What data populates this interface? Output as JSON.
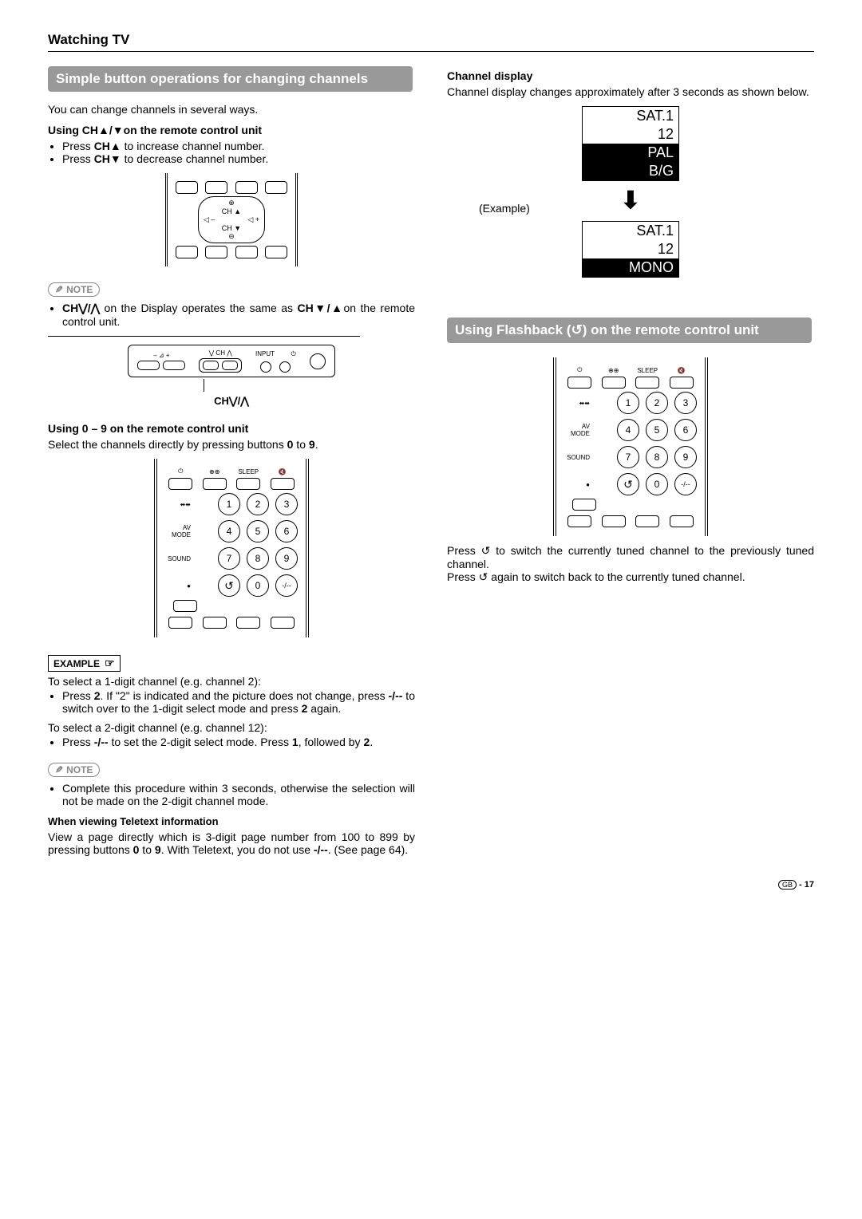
{
  "page": {
    "title": "Watching TV",
    "footer_region": "GB",
    "footer_page": "- 17"
  },
  "leftCol": {
    "bar": "Simple button operations for changing channels",
    "intro": "You can change channels in several ways.",
    "chHeading": "Using CH▲/▼on the remote control unit",
    "chBullets": [
      "Press CH▲ to increase channel number.",
      "Press CH▼ to decrease channel number."
    ],
    "remote1": {
      "ch_up": "CH ▲",
      "ch_down": "CH ▼"
    },
    "note1_label": "NOTE",
    "note1_text": "CH⋁/⋀ on the Display operates the same as CH▼/▲on the remote control unit.",
    "top_panel": {
      "lbl_vol": "– ⊿ +",
      "lbl_ch": "⋁ CH ⋀",
      "lbl_input": "INPUT",
      "lbl_standby": "⏻"
    },
    "top_panel_caption": "CH⋁/⋀",
    "numHeading": "Using 0 – 9 on the remote control unit",
    "numIntro": "Select the channels directly by pressing buttons 0 to 9.",
    "numpad": {
      "top_labels": [
        "⏻",
        "⊕⊕",
        "SLEEP",
        "🔇"
      ],
      "side_labels": [
        "⬌⬌",
        "AV MODE",
        "SOUND",
        "●"
      ],
      "numbers": [
        "1",
        "2",
        "3",
        "4",
        "5",
        "6",
        "7",
        "8",
        "9",
        "↺",
        "0",
        "-/--"
      ]
    },
    "example_label": "EXAMPLE",
    "example_1_lead": "To select a 1-digit channel (e.g. channel 2):",
    "example_1_bullet": "Press 2. If \"2\" is indicated and the picture does not change, press -/-- to switch over to the 1-digit select mode and press 2 again.",
    "example_2_lead": "To select a 2-digit channel (e.g. channel 12):",
    "example_2_bullet": "Press -/-- to set the 2-digit select mode. Press 1, followed by 2.",
    "note2_label": "NOTE",
    "note2_text": "Complete this procedure within 3 seconds, otherwise the selection will not be made on the 2-digit channel mode.",
    "teletext_head": "When viewing Teletext information",
    "teletext_text": "View a page directly which is 3-digit page number from 100 to 899 by pressing buttons 0 to 9. With Teletext, you do not use -/--. (See page 64)."
  },
  "rightCol": {
    "chDispHead": "Channel display",
    "chDispText": "Channel display changes approximately after 3 seconds as shown below.",
    "osd_example_label": "(Example)",
    "osd1": {
      "l1": "SAT.1",
      "l2": "12",
      "l3": "PAL",
      "l4": "B/G"
    },
    "osd2": {
      "l1": "SAT.1",
      "l2": "12",
      "l3": "MONO"
    },
    "flashBar": "Using Flashback (↺) on the remote control unit",
    "flashNumpad": {
      "top_labels": [
        "⏻",
        "⊕⊕",
        "SLEEP",
        "🔇"
      ],
      "side_labels": [
        "⬌⬌",
        "AV MODE",
        "SOUND",
        "●"
      ],
      "numbers": [
        "1",
        "2",
        "3",
        "4",
        "5",
        "6",
        "7",
        "8",
        "9",
        "↺",
        "0",
        "-/--"
      ]
    },
    "flash_p1": "Press ↺ to switch the currently tuned channel to the previously tuned channel.",
    "flash_p2": "Press ↺ again to switch back to the currently tuned channel."
  }
}
